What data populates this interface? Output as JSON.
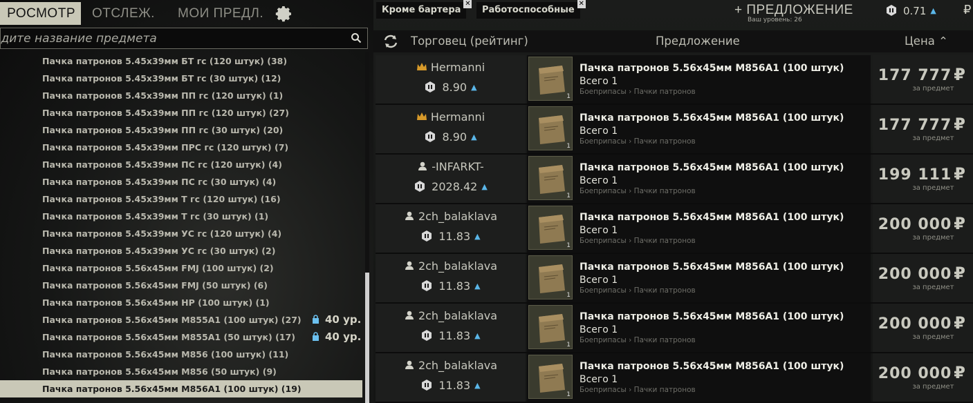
{
  "tabs": {
    "browse": "РОСМОТР",
    "track": "ОТСЛЕЖ.",
    "my_offers": "МОИ ПРЕДЛ."
  },
  "search": {
    "placeholder": "едите название предмета"
  },
  "item_list": [
    "Пачка патронов 5.45x39мм БТ гс (120 штук) (38)",
    "Пачка патронов 5.45x39мм БТ гс (30 штук) (12)",
    "Пачка патронов 5.45x39мм ПП гс (120 штук) (1)",
    "Пачка патронов 5.45x39мм ПП гс (120 штук) (27)",
    "Пачка патронов 5.45x39мм ПП гс (30 штук) (20)",
    "Пачка патронов 5.45x39мм ПРС гс (120 штук) (7)",
    "Пачка патронов 5.45x39мм ПС гс (120 штук) (4)",
    "Пачка патронов 5.45x39мм ПС гс (30 штук) (4)",
    "Пачка патронов 5.45x39мм Т гс (120 штук) (16)",
    "Пачка патронов 5.45x39мм Т гс (30 штук) (1)",
    "Пачка патронов 5.45x39мм УС гс (120 штук) (4)",
    "Пачка патронов 5.45x39мм УС гс (30 штук) (2)",
    "Пачка патронов 5.56x45мм FMJ (100 штук) (2)",
    "Пачка патронов 5.56x45мм FMJ (50 штук) (6)",
    "Пачка патронов 5.56x45мм HP (100 штук) (1)",
    "Пачка патронов 5.56x45мм M855A1 (100 штук) (27)",
    "Пачка патронов 5.56x45мм M855A1 (50 штук) (17)",
    "Пачка патронов 5.56x45мм M856 (100 штук) (11)",
    "Пачка патронов 5.56x45мм M856 (50 штук) (9)",
    "Пачка патронов 5.56x45мм M856A1 (100 штук) (19)"
  ],
  "locked_level": "40 ур.",
  "filters": {
    "no_barter": "Кроме бартера",
    "functional": "Работоспособные"
  },
  "add_offer": "+ ПРЕДЛОЖЕНИЕ",
  "user_level": "Ваш уровень: 26",
  "reputation": "0.71",
  "currency": "₽",
  "columns": {
    "trader": "Торговец (рейтинг)",
    "offer": "Предложение",
    "price": "Цена ⌃"
  },
  "offers": [
    {
      "seller": "Hermanni",
      "seller_type": "crown-icon",
      "rating": "8.90",
      "item": "Пачка патронов 5.56x45мм M856A1 (100 штук)",
      "qty": "Всего 1",
      "category": "Боеприпасы › Пачки патронов",
      "count": "1",
      "price": "177 777",
      "per": "за предмет"
    },
    {
      "seller": "Hermanni",
      "seller_type": "crown-icon",
      "rating": "8.90",
      "item": "Пачка патронов 5.56x45мм M856A1 (100 штук)",
      "qty": "Всего 1",
      "category": "Боеприпасы › Пачки патронов",
      "count": "1",
      "price": "177 777",
      "per": "за предмет"
    },
    {
      "seller": "-INFARKT-",
      "seller_type": "person-icon",
      "rating": "2028.42",
      "item": "Пачка патронов 5.56x45мм M856A1 (100 штук)",
      "qty": "Всего 1",
      "category": "Боеприпасы › Пачки патронов",
      "count": "1",
      "price": "199 111",
      "per": "за предмет"
    },
    {
      "seller": "2ch_balaklava",
      "seller_type": "person-icon",
      "rating": "11.83",
      "item": "Пачка патронов 5.56x45мм M856A1 (100 штук)",
      "qty": "Всего 1",
      "category": "Боеприпасы › Пачки патронов",
      "count": "1",
      "price": "200 000",
      "per": "за предмет"
    },
    {
      "seller": "2ch_balaklava",
      "seller_type": "person-icon",
      "rating": "11.83",
      "item": "Пачка патронов 5.56x45мм M856A1 (100 штук)",
      "qty": "Всего 1",
      "category": "Боеприпасы › Пачки патронов",
      "count": "1",
      "price": "200 000",
      "per": "за предмет"
    },
    {
      "seller": "2ch_balaklava",
      "seller_type": "person-icon",
      "rating": "11.83",
      "item": "Пачка патронов 5.56x45мм M856A1 (100 штук)",
      "qty": "Всего 1",
      "category": "Боеприпасы › Пачки патронов",
      "count": "1",
      "price": "200 000",
      "per": "за предмет"
    },
    {
      "seller": "2ch_balaklava",
      "seller_type": "person-icon",
      "rating": "11.83",
      "item": "Пачка патронов 5.56x45мм M856A1 (100 штук)",
      "qty": "Всего 1",
      "category": "Боеприпасы › Пачки патронов",
      "count": "1",
      "price": "200 000",
      "per": "за предмет"
    }
  ],
  "colors": {
    "accent": "#c9c8b7",
    "arrow": "#5ab6e8",
    "crown": "#d79a2a"
  }
}
